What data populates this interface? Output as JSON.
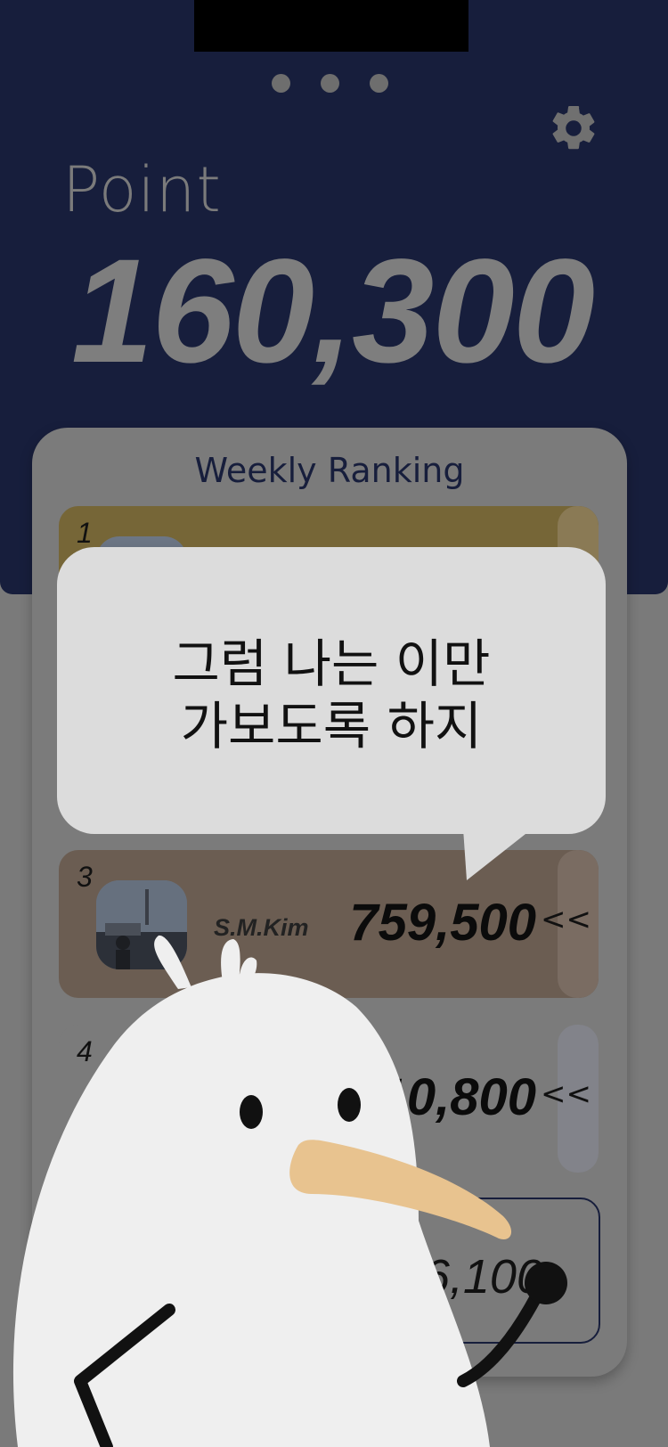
{
  "header": {
    "point_label": "Point",
    "point_value": "160,300"
  },
  "pager": {
    "page_count": 3,
    "current_page": 1
  },
  "ranking": {
    "title": "Weekly Ranking",
    "rows": [
      {
        "rank": "1",
        "name": "",
        "score": ""
      },
      {
        "rank": "3",
        "name": "S.M.Kim",
        "score": "759,500",
        "expand": "<<"
      },
      {
        "rank": "4",
        "name": "",
        "score": "710,800",
        "expand": "<<"
      }
    ],
    "my_row": {
      "score": "76,100"
    }
  },
  "bubble": {
    "line1": "그럼 나는 이만",
    "line2": "가보도록 하지"
  },
  "icons": {
    "settings": "gear-icon",
    "mascot": "kiwi-bird-mascot"
  },
  "colors": {
    "header_bg": "#171e3c",
    "gold_row": "#766637",
    "bronze_row": "#6b5d52",
    "bubble_bg": "#dcdcdc",
    "beak": "#e8c38f"
  }
}
